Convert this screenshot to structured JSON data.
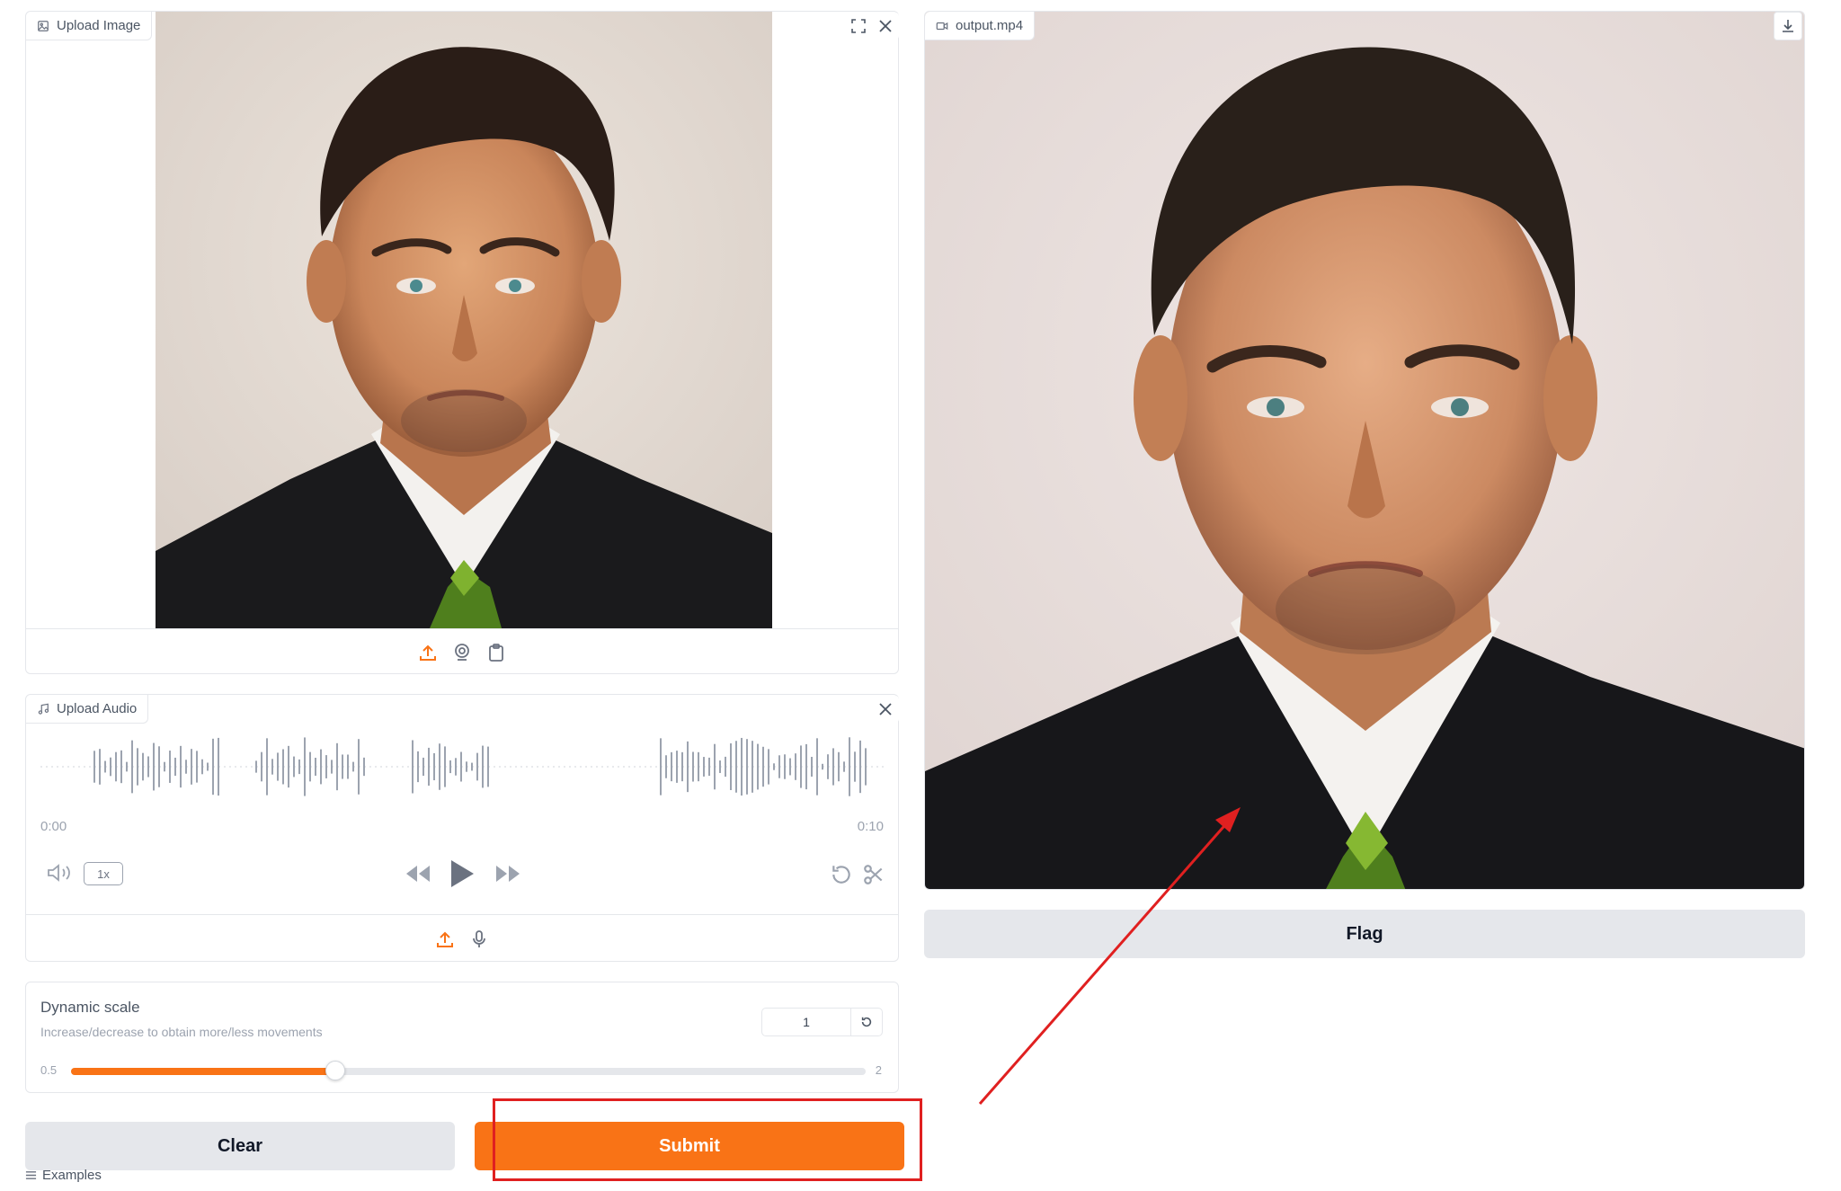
{
  "image_input": {
    "label": "Upload Image"
  },
  "audio_input": {
    "label": "Upload Audio",
    "time_start": "0:00",
    "time_end": "0:10",
    "speed": "1x"
  },
  "slider": {
    "label": "Dynamic scale",
    "info": "Increase/decrease to obtain more/less movements",
    "value": "1",
    "min": "0.5",
    "max": "2",
    "fill_fraction": 0.333
  },
  "buttons": {
    "clear": "Clear",
    "submit": "Submit",
    "flag": "Flag"
  },
  "examples": {
    "label": "Examples"
  },
  "video_output": {
    "label": "output.mp4"
  },
  "colors": {
    "accent": "#f97316",
    "annotation": "#e02020",
    "button_gray": "#e5e7eb"
  }
}
